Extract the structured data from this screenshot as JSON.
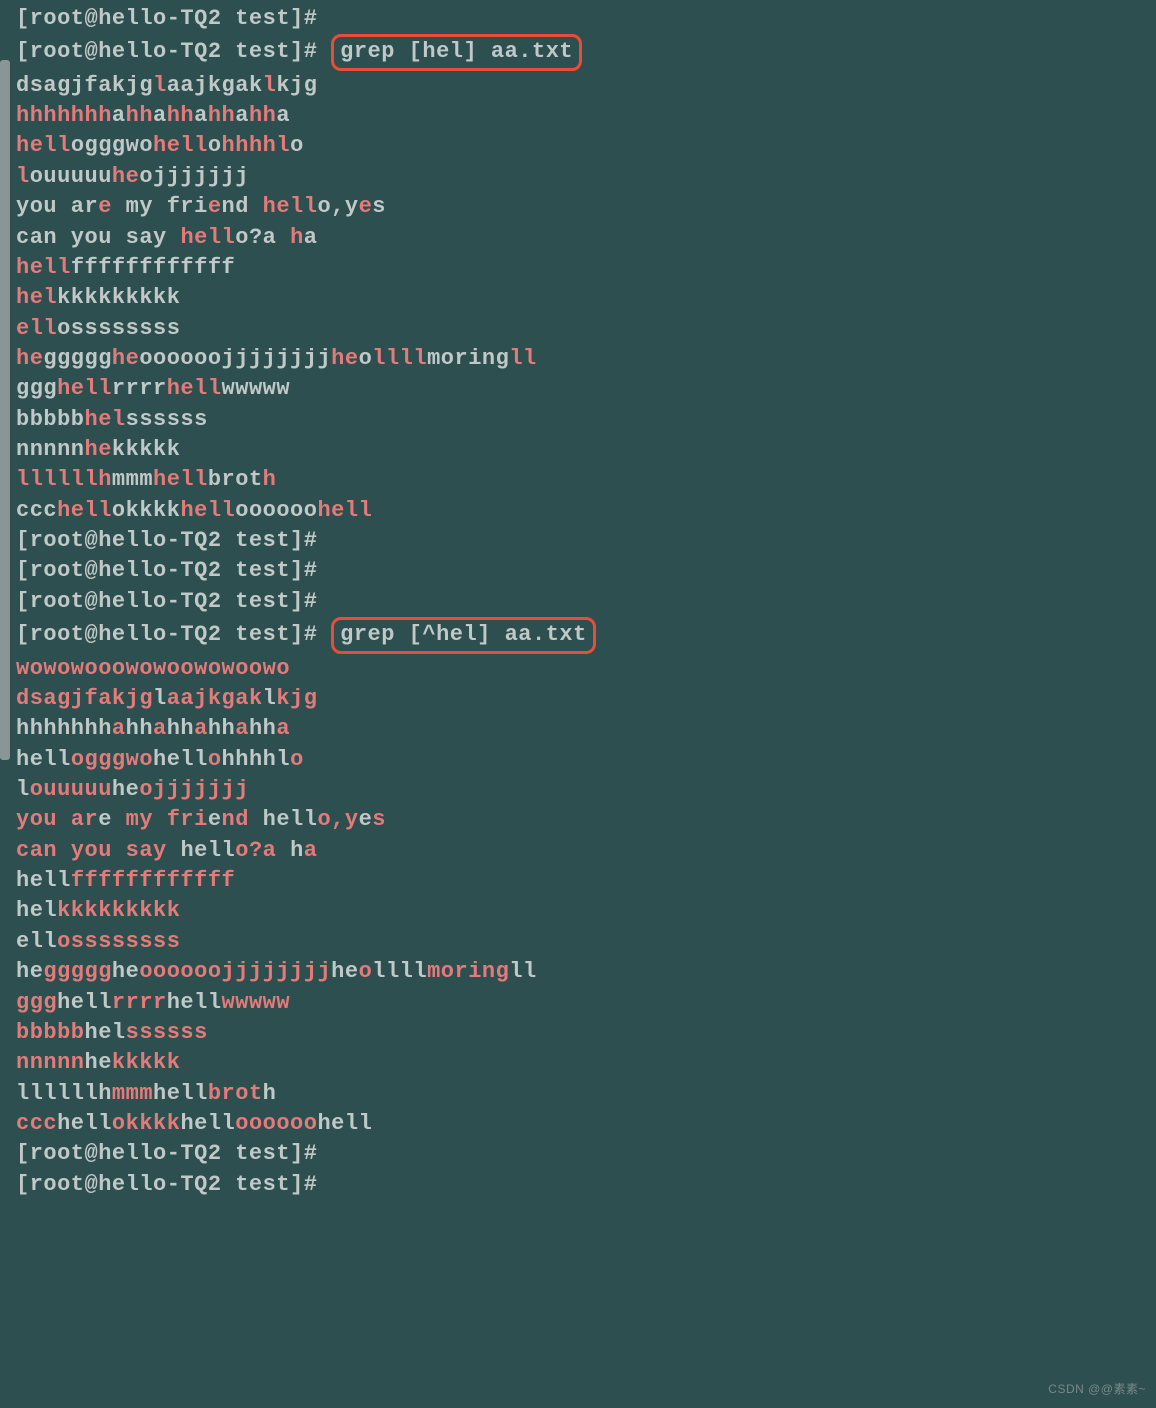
{
  "prompt": "[root@hello-TQ2 test]# ",
  "cmd1_text": "grep [hel] aa.txt",
  "cmd2_text": "grep [^hel] aa.txt",
  "watermark": "CSDN @@素素~",
  "section1": [
    [
      {
        "t": "dsagjfakjg",
        "h": 0
      },
      {
        "t": "l",
        "h": 1
      },
      {
        "t": "aajkgak",
        "h": 0
      },
      {
        "t": "l",
        "h": 1
      },
      {
        "t": "kjg",
        "h": 0
      }
    ],
    [
      {
        "t": "hhhhhhh",
        "h": 1
      },
      {
        "t": "a",
        "h": 0
      },
      {
        "t": "hh",
        "h": 1
      },
      {
        "t": "a",
        "h": 0
      },
      {
        "t": "hh",
        "h": 1
      },
      {
        "t": "a",
        "h": 0
      },
      {
        "t": "hh",
        "h": 1
      },
      {
        "t": "a",
        "h": 0
      },
      {
        "t": "hh",
        "h": 1
      },
      {
        "t": "a",
        "h": 0
      }
    ],
    [
      {
        "t": "hell",
        "h": 1
      },
      {
        "t": "ogggwo",
        "h": 0
      },
      {
        "t": "hell",
        "h": 1
      },
      {
        "t": "o",
        "h": 0
      },
      {
        "t": "hhhhl",
        "h": 1
      },
      {
        "t": "o",
        "h": 0
      }
    ],
    [
      {
        "t": "l",
        "h": 1
      },
      {
        "t": "ouuuuu",
        "h": 0
      },
      {
        "t": "he",
        "h": 1
      },
      {
        "t": "ojjjjjjj",
        "h": 0
      }
    ],
    [
      {
        "t": "you ar",
        "h": 0
      },
      {
        "t": "e",
        "h": 1
      },
      {
        "t": " my fri",
        "h": 0
      },
      {
        "t": "e",
        "h": 1
      },
      {
        "t": "nd ",
        "h": 0
      },
      {
        "t": "hell",
        "h": 1
      },
      {
        "t": "o,y",
        "h": 0
      },
      {
        "t": "e",
        "h": 1
      },
      {
        "t": "s",
        "h": 0
      }
    ],
    [
      {
        "t": "can you say ",
        "h": 0
      },
      {
        "t": "hell",
        "h": 1
      },
      {
        "t": "o?a ",
        "h": 0
      },
      {
        "t": "h",
        "h": 1
      },
      {
        "t": "a",
        "h": 0
      }
    ],
    [
      {
        "t": "hell",
        "h": 1
      },
      {
        "t": "ffffffffffff",
        "h": 0
      }
    ],
    [
      {
        "t": "hel",
        "h": 1
      },
      {
        "t": "kkkkkkkkk",
        "h": 0
      }
    ],
    [
      {
        "t": "ell",
        "h": 1
      },
      {
        "t": "ossssssss",
        "h": 0
      }
    ],
    [
      {
        "t": "he",
        "h": 1
      },
      {
        "t": "ggggg",
        "h": 0
      },
      {
        "t": "he",
        "h": 1
      },
      {
        "t": "oooooojjjjjjjj",
        "h": 0
      },
      {
        "t": "he",
        "h": 1
      },
      {
        "t": "o",
        "h": 0
      },
      {
        "t": "llll",
        "h": 1
      },
      {
        "t": "moring",
        "h": 0
      },
      {
        "t": "ll",
        "h": 1
      }
    ],
    [
      {
        "t": "ggg",
        "h": 0
      },
      {
        "t": "hell",
        "h": 1
      },
      {
        "t": "rrrr",
        "h": 0
      },
      {
        "t": "hell",
        "h": 1
      },
      {
        "t": "wwwww",
        "h": 0
      }
    ],
    [
      {
        "t": "bbbbb",
        "h": 0
      },
      {
        "t": "hel",
        "h": 1
      },
      {
        "t": "ssssss",
        "h": 0
      }
    ],
    [
      {
        "t": "nnnnn",
        "h": 0
      },
      {
        "t": "he",
        "h": 1
      },
      {
        "t": "kkkkk",
        "h": 0
      }
    ],
    [
      {
        "t": "llllllh",
        "h": 1
      },
      {
        "t": "mmm",
        "h": 0
      },
      {
        "t": "hell",
        "h": 1
      },
      {
        "t": "brot",
        "h": 0
      },
      {
        "t": "h",
        "h": 1
      }
    ],
    [
      {
        "t": "ccc",
        "h": 0
      },
      {
        "t": "hell",
        "h": 1
      },
      {
        "t": "okkkk",
        "h": 0
      },
      {
        "t": "hell",
        "h": 1
      },
      {
        "t": "oooooo",
        "h": 0
      },
      {
        "t": "hell",
        "h": 1
      }
    ]
  ],
  "empty_prompts_1": 3,
  "section2": [
    [
      {
        "t": "wowowooowowoowowoowo",
        "h": 1
      }
    ],
    [
      {
        "t": "dsagjfakjg",
        "h": 1
      },
      {
        "t": "l",
        "h": 0
      },
      {
        "t": "aajkgak",
        "h": 1
      },
      {
        "t": "l",
        "h": 0
      },
      {
        "t": "kjg",
        "h": 1
      }
    ],
    [
      {
        "t": "hhhhhhh",
        "h": 0
      },
      {
        "t": "a",
        "h": 1
      },
      {
        "t": "hh",
        "h": 0
      },
      {
        "t": "a",
        "h": 1
      },
      {
        "t": "hh",
        "h": 0
      },
      {
        "t": "a",
        "h": 1
      },
      {
        "t": "hh",
        "h": 0
      },
      {
        "t": "a",
        "h": 1
      },
      {
        "t": "hh",
        "h": 0
      },
      {
        "t": "a",
        "h": 1
      }
    ],
    [
      {
        "t": "hell",
        "h": 0
      },
      {
        "t": "ogggwo",
        "h": 1
      },
      {
        "t": "hell",
        "h": 0
      },
      {
        "t": "o",
        "h": 1
      },
      {
        "t": "hhhhl",
        "h": 0
      },
      {
        "t": "o",
        "h": 1
      }
    ],
    [
      {
        "t": "l",
        "h": 0
      },
      {
        "t": "ouuuuu",
        "h": 1
      },
      {
        "t": "he",
        "h": 0
      },
      {
        "t": "ojjjjjjj",
        "h": 1
      }
    ],
    [
      {
        "t": "you ar",
        "h": 1
      },
      {
        "t": "e",
        "h": 0
      },
      {
        "t": " my fri",
        "h": 1
      },
      {
        "t": "e",
        "h": 0
      },
      {
        "t": "nd ",
        "h": 1
      },
      {
        "t": "hell",
        "h": 0
      },
      {
        "t": "o,y",
        "h": 1
      },
      {
        "t": "e",
        "h": 0
      },
      {
        "t": "s",
        "h": 1
      }
    ],
    [
      {
        "t": "can you say ",
        "h": 1
      },
      {
        "t": "hell",
        "h": 0
      },
      {
        "t": "o?a ",
        "h": 1
      },
      {
        "t": "h",
        "h": 0
      },
      {
        "t": "a",
        "h": 1
      }
    ],
    [
      {
        "t": "hell",
        "h": 0
      },
      {
        "t": "ffffffffffff",
        "h": 1
      }
    ],
    [
      {
        "t": "hel",
        "h": 0
      },
      {
        "t": "kkkkkkkkk",
        "h": 1
      }
    ],
    [
      {
        "t": "ell",
        "h": 0
      },
      {
        "t": "ossssssss",
        "h": 1
      }
    ],
    [
      {
        "t": "he",
        "h": 0
      },
      {
        "t": "ggggg",
        "h": 1
      },
      {
        "t": "he",
        "h": 0
      },
      {
        "t": "oooooojjjjjjjj",
        "h": 1
      },
      {
        "t": "he",
        "h": 0
      },
      {
        "t": "o",
        "h": 1
      },
      {
        "t": "llll",
        "h": 0
      },
      {
        "t": "moring",
        "h": 1
      },
      {
        "t": "ll",
        "h": 0
      }
    ],
    [
      {
        "t": "ggg",
        "h": 1
      },
      {
        "t": "hell",
        "h": 0
      },
      {
        "t": "rrrr",
        "h": 1
      },
      {
        "t": "hell",
        "h": 0
      },
      {
        "t": "wwwww",
        "h": 1
      }
    ],
    [
      {
        "t": "bbbbb",
        "h": 1
      },
      {
        "t": "hel",
        "h": 0
      },
      {
        "t": "ssssss",
        "h": 1
      }
    ],
    [
      {
        "t": "nnnnn",
        "h": 1
      },
      {
        "t": "he",
        "h": 0
      },
      {
        "t": "kkkkk",
        "h": 1
      }
    ],
    [
      {
        "t": "llllllh",
        "h": 0
      },
      {
        "t": "mmm",
        "h": 1
      },
      {
        "t": "hell",
        "h": 0
      },
      {
        "t": "brot",
        "h": 1
      },
      {
        "t": "h",
        "h": 0
      }
    ],
    [
      {
        "t": "ccc",
        "h": 1
      },
      {
        "t": "hell",
        "h": 0
      },
      {
        "t": "okkkk",
        "h": 1
      },
      {
        "t": "hell",
        "h": 0
      },
      {
        "t": "oooooo",
        "h": 1
      },
      {
        "t": "hell",
        "h": 0
      }
    ]
  ],
  "empty_prompts_2": 2
}
